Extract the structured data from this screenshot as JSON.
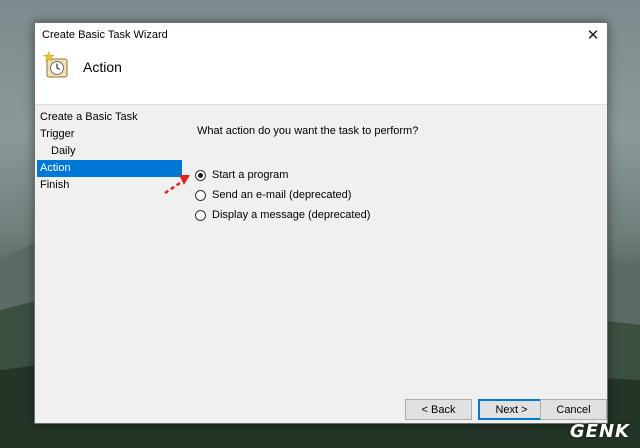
{
  "window": {
    "title": "Create Basic Task Wizard",
    "close_glyph": "✕"
  },
  "header": {
    "icon": "task-scheduler-icon",
    "title": "Action"
  },
  "nav": {
    "items": [
      {
        "label": "Create a Basic Task",
        "selected": false
      },
      {
        "label": "Trigger",
        "selected": false
      },
      {
        "label": "Daily",
        "selected": false
      },
      {
        "label": "Action",
        "selected": true
      },
      {
        "label": "Finish",
        "selected": false
      }
    ]
  },
  "main": {
    "question": "What action do you want the task to perform?",
    "options": [
      {
        "label": "Start a program",
        "checked": true
      },
      {
        "label": "Send an e-mail (deprecated)",
        "checked": false
      },
      {
        "label": "Display a message (deprecated)",
        "checked": false
      }
    ]
  },
  "buttons": {
    "back": "< Back",
    "next": "Next >",
    "cancel": "Cancel"
  },
  "colors": {
    "selection": "#0078d7",
    "window_bg": "#f0f0f0",
    "annotation_arrow": "#e0261b"
  },
  "watermark": "GENK"
}
